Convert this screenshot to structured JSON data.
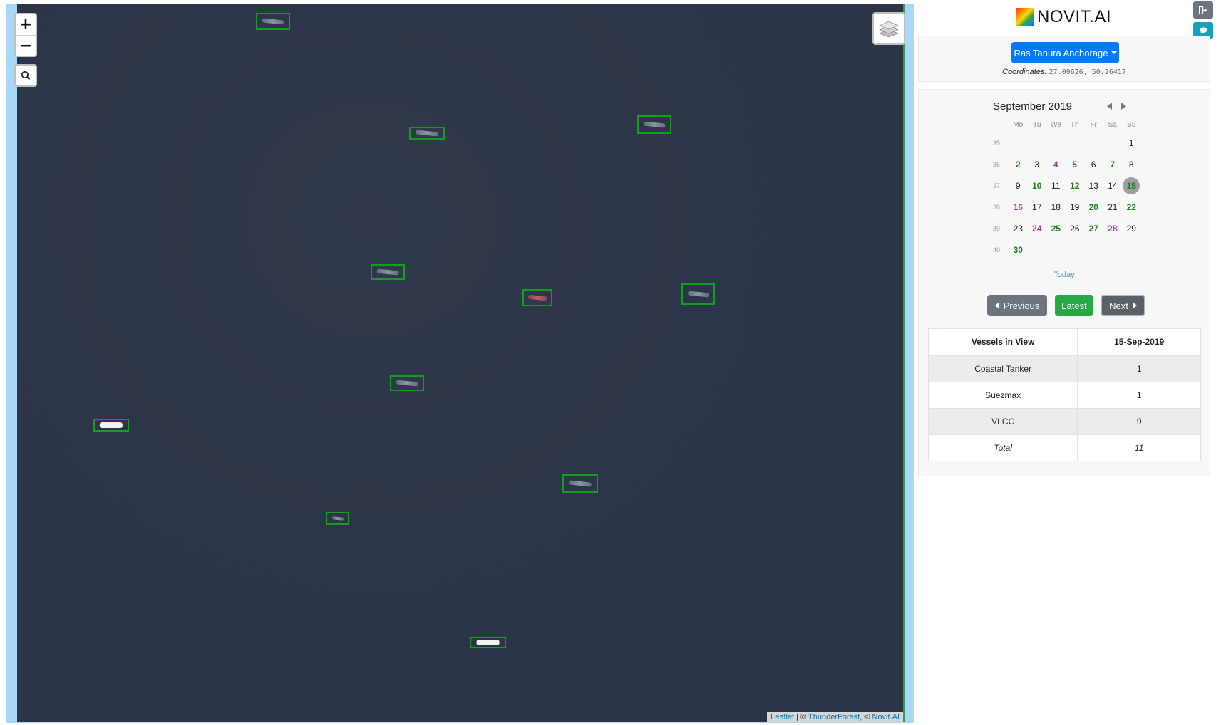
{
  "map": {
    "zoom_in": "+",
    "zoom_out": "−",
    "search_icon": "search-icon",
    "layers_icon": "layers-icon",
    "attribution": {
      "leaflet": "Leaflet",
      "sep1": " | © ",
      "thunderforest": "ThunderForest",
      "sep2": ", © ",
      "novit": "Novit.AI"
    }
  },
  "brand": {
    "name": "NOVIT.AI"
  },
  "controls": {
    "logout_icon": "sign-out-icon",
    "chat_icon": "comment-icon"
  },
  "location": {
    "selected": "Ras Tanura Anchorage",
    "coords_label": "Coordinates:",
    "coords_value": "27.09626, 50.26417"
  },
  "calendar": {
    "title": "September 2019",
    "weekdays": [
      "Mo",
      "Tu",
      "We",
      "Th",
      "Fr",
      "Sa",
      "Su"
    ],
    "weeks": [
      {
        "num": "35",
        "days": [
          {
            "d": "",
            "s": ""
          },
          {
            "d": "",
            "s": ""
          },
          {
            "d": "",
            "s": ""
          },
          {
            "d": "",
            "s": ""
          },
          {
            "d": "",
            "s": ""
          },
          {
            "d": "",
            "s": ""
          },
          {
            "d": "1",
            "s": ""
          }
        ]
      },
      {
        "num": "36",
        "days": [
          {
            "d": "2",
            "s": "green"
          },
          {
            "d": "3",
            "s": ""
          },
          {
            "d": "4",
            "s": "purple"
          },
          {
            "d": "5",
            "s": "green"
          },
          {
            "d": "6",
            "s": ""
          },
          {
            "d": "7",
            "s": "green"
          },
          {
            "d": "8",
            "s": ""
          }
        ]
      },
      {
        "num": "37",
        "days": [
          {
            "d": "9",
            "s": ""
          },
          {
            "d": "10",
            "s": "green"
          },
          {
            "d": "11",
            "s": ""
          },
          {
            "d": "12",
            "s": "green"
          },
          {
            "d": "13",
            "s": ""
          },
          {
            "d": "14",
            "s": ""
          },
          {
            "d": "15",
            "s": "selected"
          }
        ]
      },
      {
        "num": "38",
        "days": [
          {
            "d": "16",
            "s": "purple"
          },
          {
            "d": "17",
            "s": ""
          },
          {
            "d": "18",
            "s": ""
          },
          {
            "d": "19",
            "s": ""
          },
          {
            "d": "20",
            "s": "green"
          },
          {
            "d": "21",
            "s": ""
          },
          {
            "d": "22",
            "s": "green"
          }
        ]
      },
      {
        "num": "39",
        "days": [
          {
            "d": "23",
            "s": ""
          },
          {
            "d": "24",
            "s": "purple"
          },
          {
            "d": "25",
            "s": "green"
          },
          {
            "d": "26",
            "s": ""
          },
          {
            "d": "27",
            "s": "green"
          },
          {
            "d": "28",
            "s": "purple"
          },
          {
            "d": "29",
            "s": ""
          }
        ]
      },
      {
        "num": "40",
        "days": [
          {
            "d": "30",
            "s": "green"
          },
          {
            "d": "",
            "s": ""
          },
          {
            "d": "",
            "s": ""
          },
          {
            "d": "",
            "s": ""
          },
          {
            "d": "",
            "s": ""
          },
          {
            "d": "",
            "s": ""
          },
          {
            "d": "",
            "s": ""
          }
        ]
      }
    ],
    "today_label": "Today"
  },
  "nav": {
    "previous": "Previous",
    "latest": "Latest",
    "next": "Next"
  },
  "vessels": {
    "header_label": "Vessels in View",
    "header_date": "15-Sep-2019",
    "rows": [
      {
        "type": "Coastal Tanker",
        "count": "1"
      },
      {
        "type": "Suezmax",
        "count": "1"
      },
      {
        "type": "VLCC",
        "count": "9"
      }
    ],
    "total_label": "Total",
    "total_value": "11"
  },
  "colors": {
    "map_water": "#2c3447",
    "detection_box": "#14a01e",
    "primary": "#007bff",
    "success": "#28a745",
    "secondary": "#6c757d",
    "info": "#17a2b8"
  }
}
